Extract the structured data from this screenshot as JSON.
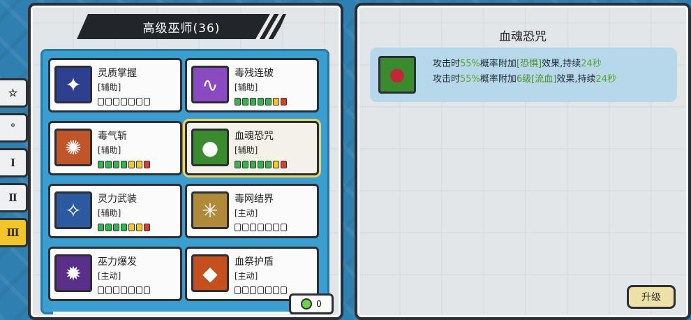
{
  "header": {
    "title": "高级巫师(36)"
  },
  "side_tabs": [
    {
      "label": "☆",
      "active": false
    },
    {
      "label": "°",
      "active": false
    },
    {
      "label": "Ⅰ",
      "active": false
    },
    {
      "label": "Ⅱ",
      "active": false
    },
    {
      "label": "Ⅲ",
      "active": true
    }
  ],
  "skills": [
    {
      "name": "灵质掌握",
      "type": "[辅助]",
      "icon": "spirit-mastery-icon",
      "icon_color": "#2f3f8f",
      "glyph": "✦",
      "dots": [
        "e",
        "e",
        "e",
        "e",
        "e",
        "e",
        "e"
      ]
    },
    {
      "name": "毒残连破",
      "type": "[辅助]",
      "icon": "poison-chain-icon",
      "icon_color": "#8a4bc0",
      "glyph": "∿",
      "dots": [
        "g",
        "g",
        "g",
        "g",
        "g",
        "y",
        "r"
      ]
    },
    {
      "name": "毒气斩",
      "type": "[辅助]",
      "icon": "poison-slash-icon",
      "icon_color": "#c0552a",
      "glyph": "✺",
      "dots": [
        "g",
        "g",
        "g",
        "g",
        "y",
        "y",
        "r"
      ]
    },
    {
      "name": "血魂恐咒",
      "type": "[辅助]",
      "icon": "blood-soul-curse-icon",
      "icon_color": "#3a8a2e",
      "glyph": "●",
      "dots": [
        "g",
        "g",
        "g",
        "g",
        "g",
        "y",
        "r"
      ],
      "selected": true
    },
    {
      "name": "灵力武装",
      "type": "[辅助]",
      "icon": "spirit-armament-icon",
      "icon_color": "#2c5aa0",
      "glyph": "✧",
      "dots": [
        "g",
        "g",
        "g",
        "g",
        "y",
        "y",
        "r"
      ]
    },
    {
      "name": "毒网结界",
      "type": "[主动]",
      "icon": "poison-web-icon",
      "icon_color": "#b08a3a",
      "glyph": "✳",
      "dots": [
        "e",
        "e",
        "e",
        "e",
        "e",
        "e",
        "e"
      ]
    },
    {
      "name": "巫力爆发",
      "type": "[主动]",
      "icon": "witch-burst-icon",
      "icon_color": "#5a2f8a",
      "glyph": "✹",
      "dots": [
        "e",
        "e",
        "e",
        "e",
        "e",
        "e",
        "e"
      ]
    },
    {
      "name": "血祭护盾",
      "type": "[主动]",
      "icon": "blood-shield-icon",
      "icon_color": "#c4501f",
      "glyph": "◆",
      "dots": [
        "e",
        "e",
        "e",
        "e",
        "e",
        "e",
        "e"
      ]
    }
  ],
  "counter": {
    "value": "0"
  },
  "detail": {
    "title": "血魂恐咒",
    "icon": "blood-soul-curse-icon",
    "line1": {
      "a": "攻击时",
      "b": "55%",
      "c": "概率附加",
      "d": "[恐惧]",
      "e": "效果,持续",
      "f": "24秒"
    },
    "line2": {
      "a": "攻击时",
      "b": "55%",
      "c": "概率附加",
      "d": "6级",
      "e": "[流血]",
      "f": "效果,持续",
      "g": "24秒"
    }
  },
  "upgrade_label": "升级"
}
